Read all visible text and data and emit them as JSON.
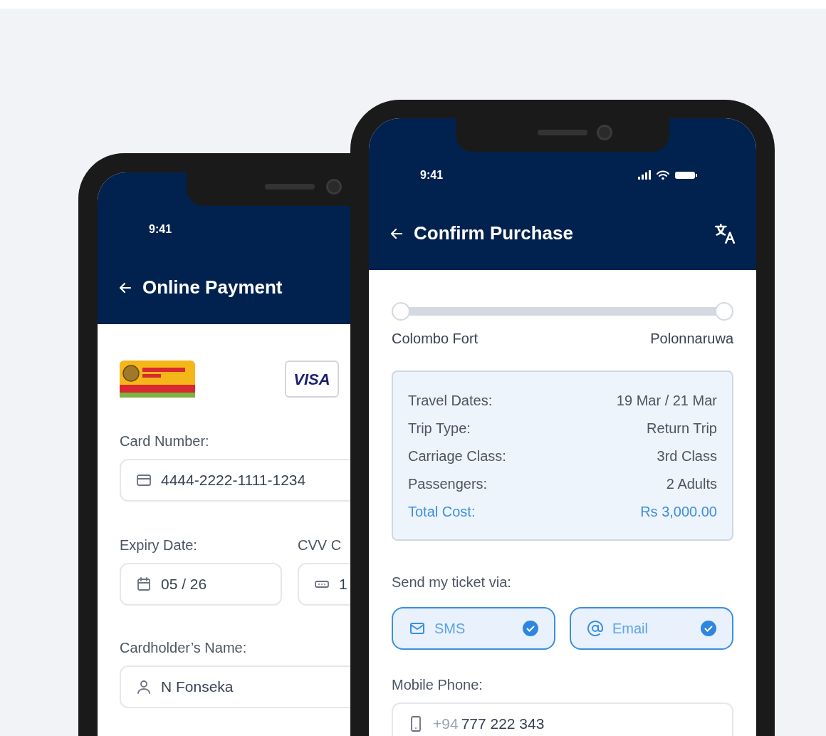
{
  "payment_screen": {
    "status_time": "9:41",
    "title": "Online Payment",
    "card_logo": "VISA",
    "card_number": {
      "label": "Card Number:",
      "value": "4444-2222-1111-1234"
    },
    "expiry": {
      "label": "Expiry Date:",
      "value": "05 / 26"
    },
    "cvv": {
      "label": "CVV C",
      "value": "1"
    },
    "cardholder": {
      "label": "Cardholder’s Name:",
      "value": "N Fonseka"
    }
  },
  "confirm_screen": {
    "status_time": "9:41",
    "title": "Confirm Purchase",
    "route": {
      "from": "Colombo Fort",
      "to": "Polonnaruwa"
    },
    "summary": [
      {
        "kind": "detail",
        "label": "Travel Dates:",
        "value": "19 Mar / 21 Mar"
      },
      {
        "kind": "detail",
        "label": "Trip Type:",
        "value": "Return Trip"
      },
      {
        "kind": "detail",
        "label": "Carriage Class:",
        "value": "3rd Class"
      },
      {
        "kind": "detail",
        "label": "Passengers:",
        "value": "2 Adults"
      },
      {
        "kind": "total",
        "label": "Total Cost:",
        "value": "Rs 3,000.00"
      }
    ],
    "delivery": {
      "label": "Send my ticket via:",
      "options": [
        {
          "kind": "sms",
          "label": "SMS",
          "checked": true
        },
        {
          "kind": "email",
          "label": "Email",
          "checked": true
        }
      ]
    },
    "mobile_phone": {
      "label": "Mobile Phone:",
      "prefix": "+94",
      "value": "777 222 343"
    }
  }
}
